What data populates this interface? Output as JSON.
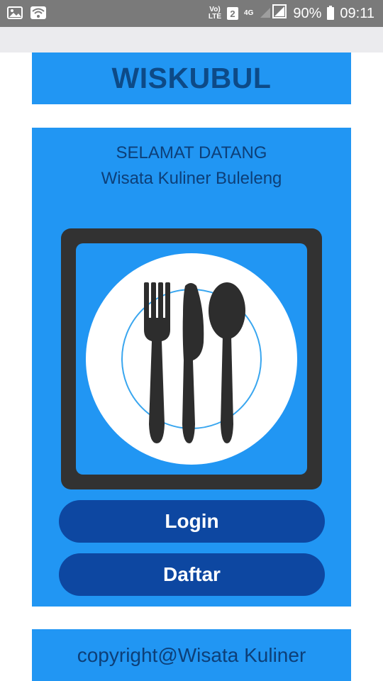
{
  "status_bar": {
    "volte_label": "Vo)\nLTE",
    "sim_badge": "2",
    "network_label": "4G",
    "battery_percent": "90%",
    "time": "09:11"
  },
  "header": {
    "title": "WISKUBUL"
  },
  "welcome": {
    "line1": "SELAMAT DATANG",
    "line2": "Wisata Kuliner Buleleng"
  },
  "logo": {
    "icon": "plate-cutlery-icon"
  },
  "buttons": {
    "login_label": "Login",
    "daftar_label": "Daftar"
  },
  "footer": {
    "text": "copyright@Wisata Kuliner"
  },
  "colors": {
    "accent": "#2196f3",
    "button": "#0d47a1",
    "title_text": "#0d4a87",
    "status_bar": "#7a7a7a"
  }
}
